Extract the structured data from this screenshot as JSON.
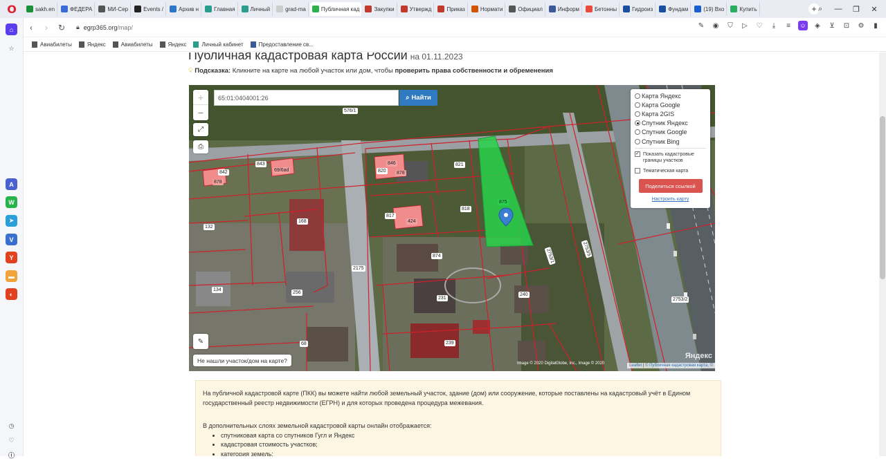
{
  "browser": {
    "tabs": [
      {
        "label": "sakh.en",
        "color": "#1b8f3a"
      },
      {
        "label": "ФЕДЕРА",
        "color": "#3b6bd4"
      },
      {
        "label": "МИ-Сер",
        "color": "#555555"
      },
      {
        "label": "Events /",
        "color": "#222222"
      },
      {
        "label": "Архив н",
        "color": "#2b76c9"
      },
      {
        "label": "Главная",
        "color": "#2a9d8f"
      },
      {
        "label": "Личный",
        "color": "#2a9d8f"
      },
      {
        "label": "grad-ma",
        "color": "#cccccc"
      },
      {
        "label": "Публичная кад",
        "color": "#2bb24c",
        "active": true
      },
      {
        "label": "Закупки",
        "color": "#c0392b"
      },
      {
        "label": "Утвержд",
        "color": "#c0392b"
      },
      {
        "label": "Приказ",
        "color": "#c0392b"
      },
      {
        "label": "Нормати",
        "color": "#d35400"
      },
      {
        "label": "Официал",
        "color": "#555555"
      },
      {
        "label": "Информ",
        "color": "#3c5a99"
      },
      {
        "label": "Бетонны",
        "color": "#e74c3c"
      },
      {
        "label": "Гидроиз",
        "color": "#1a4fa0"
      },
      {
        "label": "Фундам",
        "color": "#1a4fa0"
      },
      {
        "label": "(19) Вхо",
        "color": "#1a5fd0"
      },
      {
        "label": "Купить",
        "color": "#27ae60"
      }
    ],
    "new_tab": "+",
    "url_domain": "egrp365.org",
    "url_path": "/map/",
    "bookmarks": [
      "Авиабилеты",
      "Яндекс",
      "Авиабилеты",
      "Яндекс",
      "Личный кабинет",
      "Предоставление св..."
    ]
  },
  "page": {
    "title": "Публичная кадастровая карта России",
    "title_date": "на 01.11.2023",
    "hint_label": "Подсказка:",
    "hint_text": "Кликните на карте на любой участок или дом, чтобы",
    "hint_bold": "проверить права собственности и обременения"
  },
  "map": {
    "search_value": "65:01:0404001:26",
    "search_button": "Найти",
    "zoom_in": "+",
    "zoom_out": "−",
    "layers": [
      {
        "label": "Карта Яндекс",
        "selected": false
      },
      {
        "label": "Карта Google",
        "selected": false
      },
      {
        "label": "Карта 2GIS",
        "selected": false
      },
      {
        "label": "Спутник Яндекс",
        "selected": true
      },
      {
        "label": "Спутник Google",
        "selected": false
      },
      {
        "label": "Спутник Bing",
        "selected": false
      }
    ],
    "show_borders_label": "Показать кадастровые границы участков",
    "show_borders_checked": true,
    "thematic_label": "Тематическая карта",
    "thematic_checked": false,
    "share_button": "Поделиться ссылкой",
    "configure_link": "Настроить карту",
    "not_found_button": "Не нашли участок/дом на карте?",
    "imagery_credit": "Image © 2020 DigitalGlobe, Inc., Image © 2020",
    "attribution_leaflet": "Leaflet",
    "attribution_text": "© Публичная кадастровая карта, ©",
    "yandex_logo": "Яндекс",
    "plot_labels": [
      "576/1",
      "842",
      "843",
      "878",
      "69/6ad",
      "846",
      "820",
      "878",
      "821",
      "132",
      "168",
      "817",
      "424",
      "818",
      "875",
      "2175",
      "874",
      "2753/5",
      "2753/1",
      "134",
      "256",
      "231",
      "240",
      "2753/2",
      "68",
      "239"
    ]
  },
  "info": {
    "paragraph1": "На публичной кадастровой карте (ПКК) вы можете найти любой земельный участок, здание (дом) или сооружение, которые поставлены на кадастровый учёт в Едином государственный реестр недвижимости (ЕГРН) и для которых проведена процедура межевания.",
    "paragraph2": "В дополнительных слоях земельной кадастровой карты онлайн отображается:",
    "list": [
      "спутниковая карта со спутников Гугл и Яндекс",
      "кадастровая стоимость участков;",
      "категория земель;"
    ]
  },
  "colors": {
    "selected_parcel": "#27d24a",
    "cadastral_border": "#d0202a",
    "search_button": "#2f7ac0",
    "share_button": "#d9534f"
  }
}
